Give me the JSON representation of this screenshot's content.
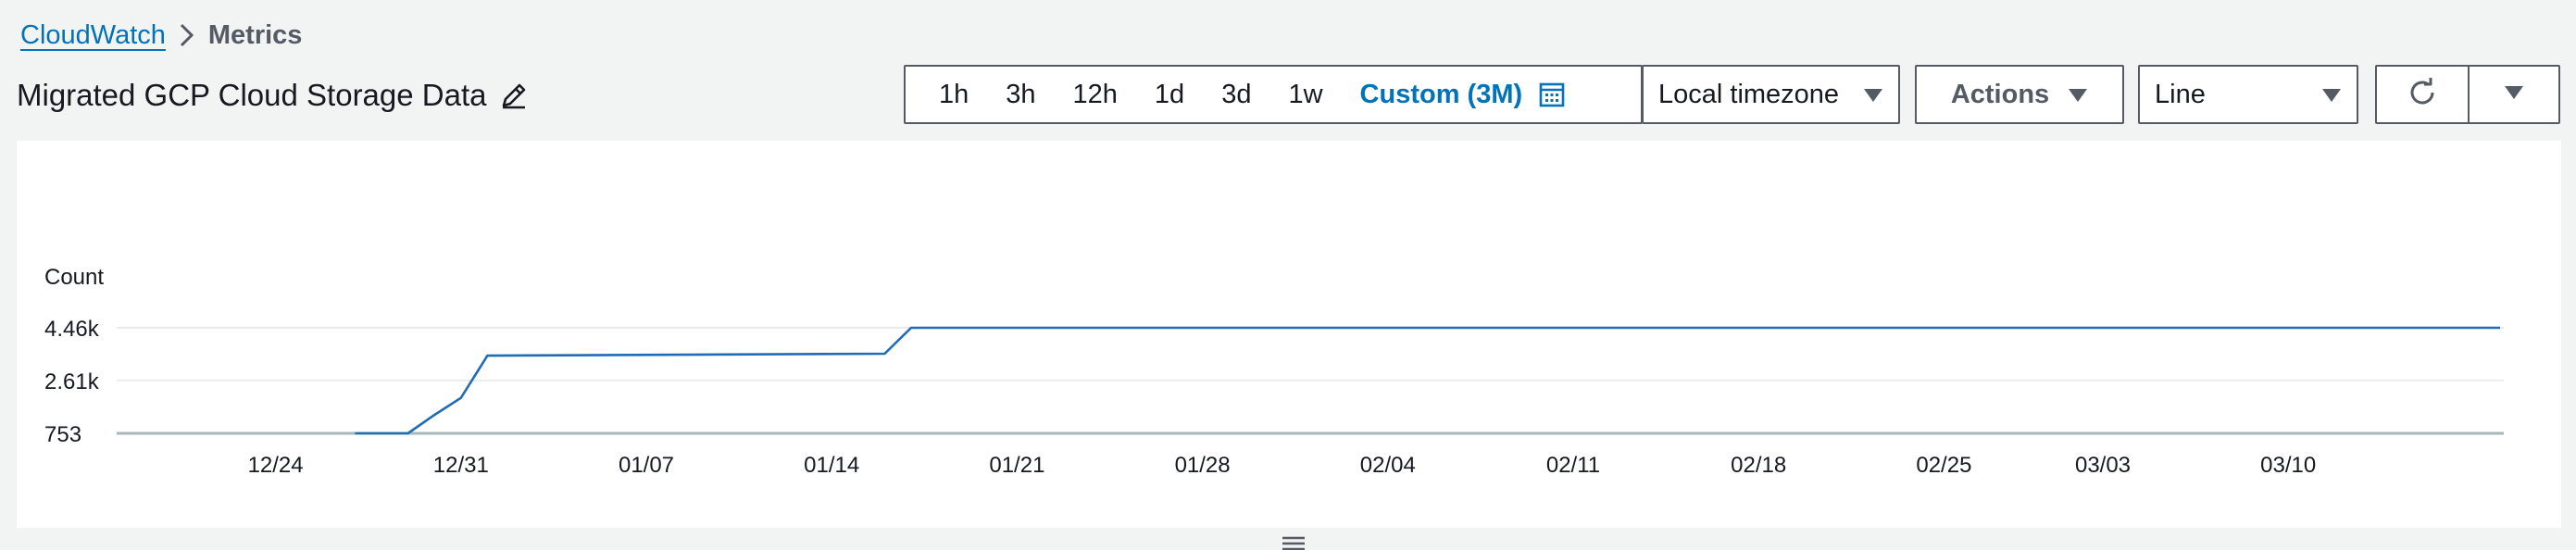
{
  "breadcrumb": {
    "root": "CloudWatch",
    "current": "Metrics"
  },
  "title": "Migrated GCP Cloud Storage Data",
  "toolbar": {
    "time_ranges": [
      "1h",
      "3h",
      "12h",
      "1d",
      "3d",
      "1w"
    ],
    "custom_label": "Custom (3M)",
    "timezone": "Local timezone",
    "actions_label": "Actions",
    "graph_type": "Line"
  },
  "icons": {
    "edit": "pencil-icon",
    "calendar": "calendar-icon",
    "caret": "caret-down-icon",
    "refresh": "refresh-icon"
  },
  "colors": {
    "link": "#0073bb",
    "series": "#1f6bb5",
    "border": "#545b64"
  },
  "chart_data": {
    "type": "line",
    "ylabel": "Count",
    "yticks": [
      {
        "label": "4.46k",
        "value": 4460
      },
      {
        "label": "2.61k",
        "value": 2610
      },
      {
        "label": "753",
        "value": 753
      }
    ],
    "ylim": [
      753,
      4460
    ],
    "xticks": [
      "12/24",
      "12/31",
      "01/07",
      "01/14",
      "01/21",
      "01/28",
      "02/04",
      "02/11",
      "02/18",
      "02/25",
      "03/03",
      "03/10"
    ],
    "xlim": [
      "12/18",
      "03/20"
    ],
    "grid": true,
    "series": [
      {
        "x": [
          "12/27",
          "12/29",
          "12/30",
          "12/31",
          "12/32",
          "01/16",
          "01/17",
          "03/18"
        ],
        "values": [
          753,
          753,
          1400,
          2000,
          3480,
          3550,
          4460,
          4460
        ]
      }
    ]
  }
}
